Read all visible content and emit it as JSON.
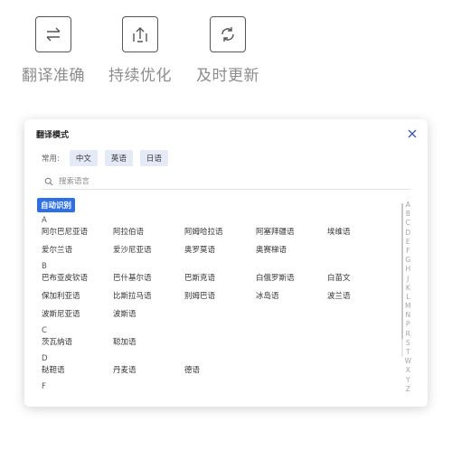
{
  "features": [
    {
      "label": "翻译准确",
      "icon": "swap-arrows-icon"
    },
    {
      "label": "持续优化",
      "icon": "upload-arrow-icon"
    },
    {
      "label": "及时更新",
      "icon": "refresh-icon"
    }
  ],
  "dialog": {
    "title": "翻译模式",
    "common_label": "常用:",
    "chips": [
      "中文",
      "英语",
      "日语"
    ],
    "search_placeholder": "搜索语言",
    "auto_detect": "自动识别",
    "groups": [
      {
        "letter": "A",
        "rows": [
          [
            "阿尔巴尼亚语",
            "阿拉伯语",
            "阿姆哈拉语",
            "阿塞拜疆语",
            "埃维语"
          ],
          [
            "爱尔兰语",
            "爱沙尼亚语",
            "奥罗莫语",
            "奥赛梯语"
          ]
        ]
      },
      {
        "letter": "B",
        "rows": [
          [
            "巴布亚皮钦语",
            "巴什基尔语",
            "巴斯克语",
            "白俄罗斯语",
            "白苗文"
          ],
          [
            "保加利亚语",
            "比斯拉马语",
            "别姆巴语",
            "冰岛语",
            "波兰语"
          ],
          [
            "波斯尼亚语",
            "波斯语"
          ]
        ]
      },
      {
        "letter": "C",
        "rows": [
          [
            "茨瓦纳语",
            "聪加语"
          ]
        ]
      },
      {
        "letter": "D",
        "rows": [
          [
            "鞑靼语",
            "丹麦语",
            "德语"
          ]
        ]
      },
      {
        "letter": "F",
        "rows": []
      }
    ],
    "alphabet": [
      "A",
      "B",
      "C",
      "D",
      "E",
      "F",
      "G",
      "H",
      "J",
      "K",
      "L",
      "M",
      "N",
      "P",
      "R",
      "S",
      "T",
      "W",
      "X",
      "Y",
      "Z"
    ]
  }
}
